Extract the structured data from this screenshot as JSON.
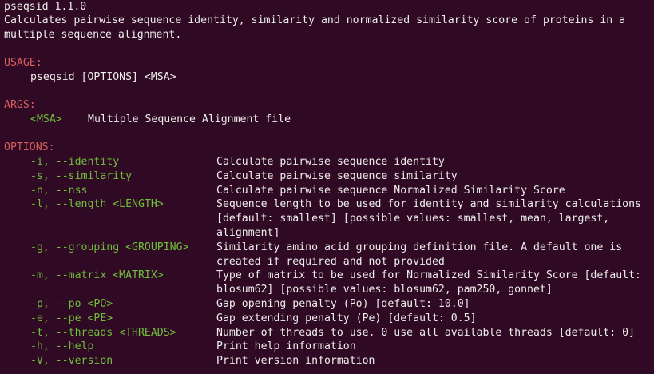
{
  "program": {
    "name_version": "pseqsid 1.1.0",
    "description_line1": "Calculates pairwise sequence identity, similarity and normalized similarity score of proteins in a",
    "description_line2": "multiple sequence alignment."
  },
  "usage": {
    "header": "USAGE:",
    "command": "pseqsid [OPTIONS] <MSA>"
  },
  "args": {
    "header": "ARGS:",
    "name": "<MSA>",
    "description": "Multiple Sequence Alignment file"
  },
  "options": {
    "header": "OPTIONS:",
    "items": [
      {
        "flag": "-i, --identity",
        "desc": [
          "Calculate pairwise sequence identity"
        ]
      },
      {
        "flag": "-s, --similarity",
        "desc": [
          "Calculate pairwise sequence similarity"
        ]
      },
      {
        "flag": "-n, --nss",
        "desc": [
          "Calculate pairwise sequence Normalized Similarity Score"
        ]
      },
      {
        "flag": "-l, --length <LENGTH>",
        "desc": [
          "Sequence length to be used for identity and similarity calculations",
          "[default: smallest] [possible values: smallest, mean, largest,",
          "alignment]"
        ]
      },
      {
        "flag": "-g, --grouping <GROUPING>",
        "desc": [
          "Similarity amino acid grouping definition file. A default one is",
          "created if required and not provided"
        ]
      },
      {
        "flag": "-m, --matrix <MATRIX>",
        "desc": [
          "Type of matrix to be used for Normalized Similarity Score [default:",
          "blosum62] [possible values: blosum62, pam250, gonnet]"
        ]
      },
      {
        "flag": "-p, --po <PO>",
        "desc": [
          "Gap opening penalty (Po) [default: 10.0]"
        ]
      },
      {
        "flag": "-e, --pe <PE>",
        "desc": [
          "Gap extending penalty (Pe) [default: 0.5]"
        ]
      },
      {
        "flag": "-t, --threads <THREADS>",
        "desc": [
          "Number of threads to use. 0 use all available threads [default: 0]"
        ]
      },
      {
        "flag": "-h, --help",
        "desc": [
          "Print help information"
        ]
      },
      {
        "flag": "-V, --version",
        "desc": [
          "Print version information"
        ]
      }
    ]
  },
  "colors": {
    "background": "#300a24",
    "text": "#eeeeec",
    "header": "#d75f5f",
    "flag": "#6fbf3a"
  }
}
